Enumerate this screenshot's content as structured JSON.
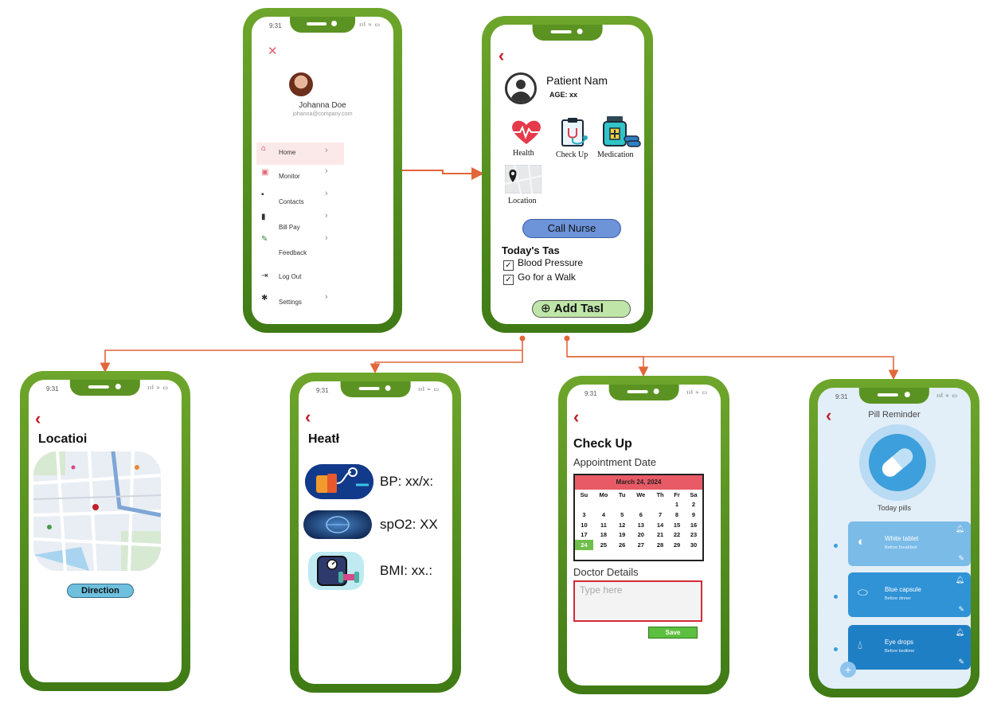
{
  "status_time": "9:31",
  "menu": {
    "user_name": "Johanna Doe",
    "user_email": "johanna@company.com",
    "items": [
      {
        "label": "Home",
        "icon": "home-icon"
      },
      {
        "label": "Monitor",
        "icon": "monitor-icon"
      },
      {
        "label": "Contacts",
        "icon": "contacts-icon"
      },
      {
        "label": "Bill Pay",
        "icon": "bill-pay-icon"
      },
      {
        "label": "Feedback",
        "icon": "feedback-icon"
      },
      {
        "label": "Log Out",
        "icon": "logout-icon"
      },
      {
        "label": "Settings",
        "icon": "settings-icon"
      }
    ]
  },
  "dashboard": {
    "patient_name": "Patient Nam",
    "age_label": "AGE: xx",
    "tiles": [
      "Health",
      "Check Up",
      "Medication",
      "Location"
    ],
    "call_nurse": "Call Nurse",
    "today_tasks_title": "Today's Tas",
    "tasks": [
      "Blood Pressure",
      "Go for a  Walk"
    ],
    "add_task": "Add Tasl"
  },
  "location": {
    "title": "Locatioi",
    "direction": "Direction"
  },
  "health": {
    "title": "Heatł",
    "values": [
      "BP: xx/x:",
      "spO2: XX",
      "BMI: xx.:"
    ]
  },
  "checkup": {
    "title": "Check Up",
    "appointment_label": "Appointment Date",
    "calendar_month": "March 24, 2024",
    "weekdays": [
      "Su",
      "Mo",
      "Tu",
      "We",
      "Th",
      "Fr",
      "Sa"
    ],
    "weeks": [
      [
        "",
        "",
        "",
        "",
        "",
        "1",
        "2"
      ],
      [
        "3",
        "4",
        "5",
        "6",
        "7",
        "8",
        "9"
      ],
      [
        "10",
        "11",
        "12",
        "13",
        "14",
        "15",
        "16"
      ],
      [
        "17",
        "18",
        "19",
        "20",
        "21",
        "22",
        "23"
      ],
      [
        "24",
        "25",
        "26",
        "27",
        "28",
        "29",
        "30"
      ]
    ],
    "doctor_label": "Doctor Details",
    "doctor_placeholder": "Type here",
    "save": "Save"
  },
  "pills": {
    "title": "Pill Reminder",
    "today_label": "Today pills",
    "cards": [
      {
        "name": "White tablet",
        "note": "Before breakfast",
        "color": "#7bbbe8"
      },
      {
        "name": "Blue capsule",
        "note": "Before dinner",
        "color": "#2f93d6"
      },
      {
        "name": "Eye drops",
        "note": "Before bedtime",
        "color": "#1f7fc4"
      }
    ],
    "fab": "+"
  },
  "colors": {
    "phone_frame": "#5b9322",
    "connector": "#e2673a",
    "accent_red": "#c0202a"
  }
}
